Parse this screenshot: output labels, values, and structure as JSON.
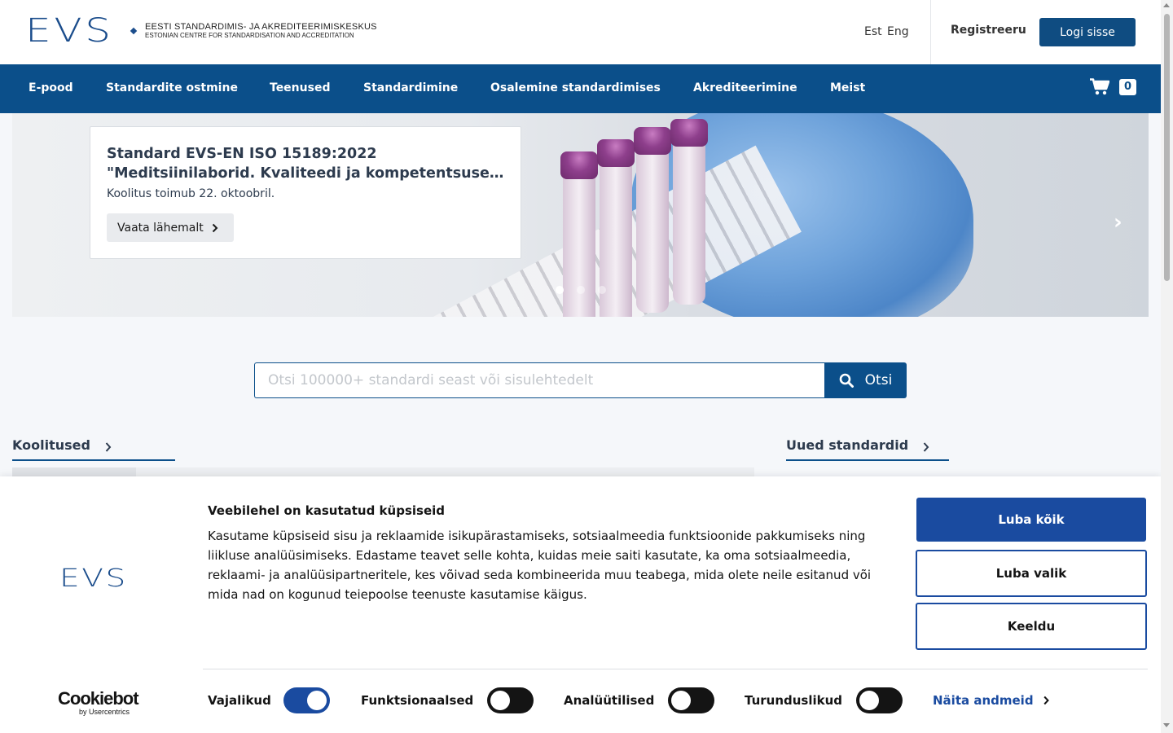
{
  "header": {
    "logo_mark": "EVS",
    "logo_line1": "EESTI STANDARDIMIS- JA AKREDITEERIMISKESKUS",
    "logo_line2": "ESTONIAN CENTRE FOR STANDARDISATION AND ACCREDITATION",
    "lang_est": "Est",
    "lang_eng": "Eng",
    "register_label": "Registreeru",
    "login_label": "Logi sisse"
  },
  "nav": {
    "items": [
      {
        "label": "E-pood"
      },
      {
        "label": "Standardite ostmine"
      },
      {
        "label": "Teenused"
      },
      {
        "label": "Standardimine"
      },
      {
        "label": "Osalemine standardimises"
      },
      {
        "label": "Akrediteerimine"
      },
      {
        "label": "Meist"
      }
    ],
    "cart_count": "0",
    "cart_icon": "shopping-cart-icon"
  },
  "hero": {
    "title_line1": "Standard EVS-EN ISO 15189:2022",
    "title_line2": "\"Meditsiinilaborid. Kvaliteedi ja kompetentsuse nõuded\"",
    "subtitle": "Koolitus toimub 22. oktoobril.",
    "button_label": "Vaata lähemalt",
    "slides_total": 3,
    "active_slide": 1
  },
  "search": {
    "placeholder": "Otsi 100000+ standardi seast või sisulehtedelt",
    "value": "",
    "button_label": "Otsi"
  },
  "sections": {
    "trainings": "Koolitused",
    "new_standards": "Uued standardid"
  },
  "cookie": {
    "logo_mark": "EVS",
    "title": "Veebilehel on kasutatud küpsiseid",
    "body": "Kasutame küpsiseid sisu ja reklaamide isikupärastamiseks, sotsiaalmeedia funktsioonide pakkumiseks ning liikluse analüüsimiseks. Edastame teavet selle kohta, kuidas meie saiti kasutate, ka oma sotsiaalmeedia, reklaami- ja analüüsipartneritele, kes võivad seda kombineerida muu teabega, mida olete neile esitanud või mida nad on kogunud teiepoolse teenuste kasutamise käigus.",
    "allow_all": "Luba kõik",
    "allow_selection": "Luba valik",
    "deny": "Keeldu",
    "brand_main": "Cookiebot",
    "brand_sub": "by Usercentrics",
    "categories": [
      {
        "label": "Vajalikud",
        "enabled": true
      },
      {
        "label": "Funktsionaalsed",
        "enabled": false
      },
      {
        "label": "Analüütilised",
        "enabled": false
      },
      {
        "label": "Turunduslikud",
        "enabled": false
      }
    ],
    "details_link": "Näita andmeid",
    "accent_color": "#1a4ba0"
  },
  "colors": {
    "brand": "#0b4f8a",
    "cookie_accent": "#1a4ba0"
  }
}
